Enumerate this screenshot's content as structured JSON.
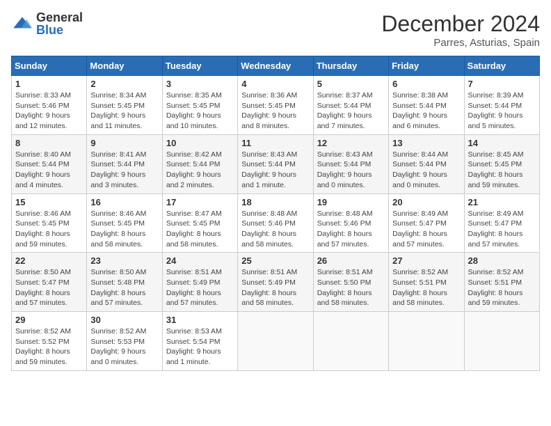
{
  "header": {
    "logo_general": "General",
    "logo_blue": "Blue",
    "month_title": "December 2024",
    "location": "Parres, Asturias, Spain"
  },
  "weekdays": [
    "Sunday",
    "Monday",
    "Tuesday",
    "Wednesday",
    "Thursday",
    "Friday",
    "Saturday"
  ],
  "weeks": [
    [
      {
        "day": "1",
        "sunrise": "8:33 AM",
        "sunset": "5:46 PM",
        "daylight": "9 hours and 12 minutes."
      },
      {
        "day": "2",
        "sunrise": "8:34 AM",
        "sunset": "5:45 PM",
        "daylight": "9 hours and 11 minutes."
      },
      {
        "day": "3",
        "sunrise": "8:35 AM",
        "sunset": "5:45 PM",
        "daylight": "9 hours and 10 minutes."
      },
      {
        "day": "4",
        "sunrise": "8:36 AM",
        "sunset": "5:45 PM",
        "daylight": "9 hours and 8 minutes."
      },
      {
        "day": "5",
        "sunrise": "8:37 AM",
        "sunset": "5:44 PM",
        "daylight": "9 hours and 7 minutes."
      },
      {
        "day": "6",
        "sunrise": "8:38 AM",
        "sunset": "5:44 PM",
        "daylight": "9 hours and 6 minutes."
      },
      {
        "day": "7",
        "sunrise": "8:39 AM",
        "sunset": "5:44 PM",
        "daylight": "9 hours and 5 minutes."
      }
    ],
    [
      {
        "day": "8",
        "sunrise": "8:40 AM",
        "sunset": "5:44 PM",
        "daylight": "9 hours and 4 minutes."
      },
      {
        "day": "9",
        "sunrise": "8:41 AM",
        "sunset": "5:44 PM",
        "daylight": "9 hours and 3 minutes."
      },
      {
        "day": "10",
        "sunrise": "8:42 AM",
        "sunset": "5:44 PM",
        "daylight": "9 hours and 2 minutes."
      },
      {
        "day": "11",
        "sunrise": "8:43 AM",
        "sunset": "5:44 PM",
        "daylight": "9 hours and 1 minute."
      },
      {
        "day": "12",
        "sunrise": "8:43 AM",
        "sunset": "5:44 PM",
        "daylight": "9 hours and 0 minutes."
      },
      {
        "day": "13",
        "sunrise": "8:44 AM",
        "sunset": "5:44 PM",
        "daylight": "9 hours and 0 minutes."
      },
      {
        "day": "14",
        "sunrise": "8:45 AM",
        "sunset": "5:45 PM",
        "daylight": "8 hours and 59 minutes."
      }
    ],
    [
      {
        "day": "15",
        "sunrise": "8:46 AM",
        "sunset": "5:45 PM",
        "daylight": "8 hours and 59 minutes."
      },
      {
        "day": "16",
        "sunrise": "8:46 AM",
        "sunset": "5:45 PM",
        "daylight": "8 hours and 58 minutes."
      },
      {
        "day": "17",
        "sunrise": "8:47 AM",
        "sunset": "5:45 PM",
        "daylight": "8 hours and 58 minutes."
      },
      {
        "day": "18",
        "sunrise": "8:48 AM",
        "sunset": "5:46 PM",
        "daylight": "8 hours and 58 minutes."
      },
      {
        "day": "19",
        "sunrise": "8:48 AM",
        "sunset": "5:46 PM",
        "daylight": "8 hours and 57 minutes."
      },
      {
        "day": "20",
        "sunrise": "8:49 AM",
        "sunset": "5:47 PM",
        "daylight": "8 hours and 57 minutes."
      },
      {
        "day": "21",
        "sunrise": "8:49 AM",
        "sunset": "5:47 PM",
        "daylight": "8 hours and 57 minutes."
      }
    ],
    [
      {
        "day": "22",
        "sunrise": "8:50 AM",
        "sunset": "5:47 PM",
        "daylight": "8 hours and 57 minutes."
      },
      {
        "day": "23",
        "sunrise": "8:50 AM",
        "sunset": "5:48 PM",
        "daylight": "8 hours and 57 minutes."
      },
      {
        "day": "24",
        "sunrise": "8:51 AM",
        "sunset": "5:49 PM",
        "daylight": "8 hours and 57 minutes."
      },
      {
        "day": "25",
        "sunrise": "8:51 AM",
        "sunset": "5:49 PM",
        "daylight": "8 hours and 58 minutes."
      },
      {
        "day": "26",
        "sunrise": "8:51 AM",
        "sunset": "5:50 PM",
        "daylight": "8 hours and 58 minutes."
      },
      {
        "day": "27",
        "sunrise": "8:52 AM",
        "sunset": "5:51 PM",
        "daylight": "8 hours and 58 minutes."
      },
      {
        "day": "28",
        "sunrise": "8:52 AM",
        "sunset": "5:51 PM",
        "daylight": "8 hours and 59 minutes."
      }
    ],
    [
      {
        "day": "29",
        "sunrise": "8:52 AM",
        "sunset": "5:52 PM",
        "daylight": "8 hours and 59 minutes."
      },
      {
        "day": "30",
        "sunrise": "8:52 AM",
        "sunset": "5:53 PM",
        "daylight": "9 hours and 0 minutes."
      },
      {
        "day": "31",
        "sunrise": "8:53 AM",
        "sunset": "5:54 PM",
        "daylight": "9 hours and 1 minute."
      },
      null,
      null,
      null,
      null
    ]
  ],
  "labels": {
    "sunrise": "Sunrise:",
    "sunset": "Sunset:",
    "daylight": "Daylight:"
  }
}
